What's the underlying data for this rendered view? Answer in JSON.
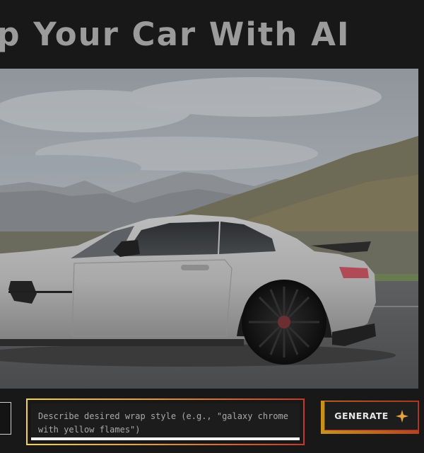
{
  "page": {
    "title": "Wrap Your Car With AI"
  },
  "hero": {
    "image_subject": "silver sports car on a mountain road",
    "icon": "car-photo"
  },
  "prompt": {
    "value": "",
    "placeholder": "Describe desired wrap style (e.g., \"galaxy chrome with yellow flames\")"
  },
  "generate_button": {
    "label": "GENERATE",
    "icon": "sparkle-icon"
  },
  "colors": {
    "background": "#181818",
    "title": "#9b9b9b",
    "accent_gold": "#f4d24a",
    "accent_orange": "#e8a23a",
    "accent_red": "#c43a2a",
    "sparkle": "#e9a33a"
  }
}
